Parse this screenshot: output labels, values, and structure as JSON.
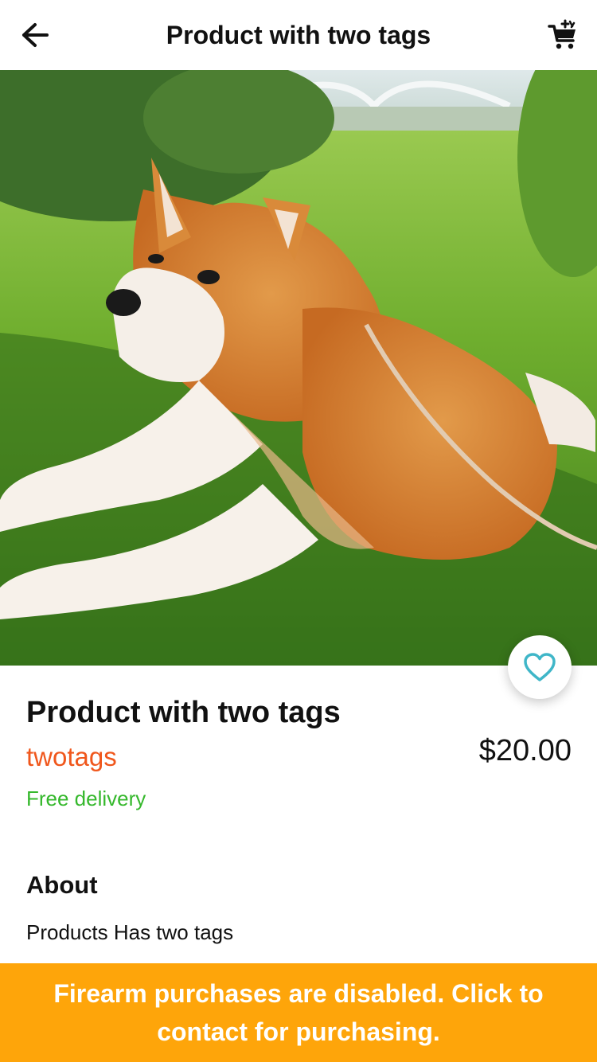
{
  "header": {
    "title": "Product with two tags",
    "back_icon": "arrow-left-icon",
    "cart_icon": "shopping-cart-icon"
  },
  "hero": {
    "image": "photo of a shiba inu dog lying on grass",
    "favorite_icon": "heart-outline-icon"
  },
  "product": {
    "title": "Product with two tags",
    "tag": "twotags",
    "price": "$20.00",
    "delivery": "Free delivery"
  },
  "about": {
    "heading": "About",
    "text": "Products Has two tags"
  },
  "banner": {
    "text": "Firearm purchases are disabled. Click to contact for purchasing."
  },
  "colors": {
    "accent_orange": "#fea50a",
    "tag_orange": "#f0571c",
    "delivery_green": "#35b82c",
    "heart_teal": "#3fb6c8"
  }
}
